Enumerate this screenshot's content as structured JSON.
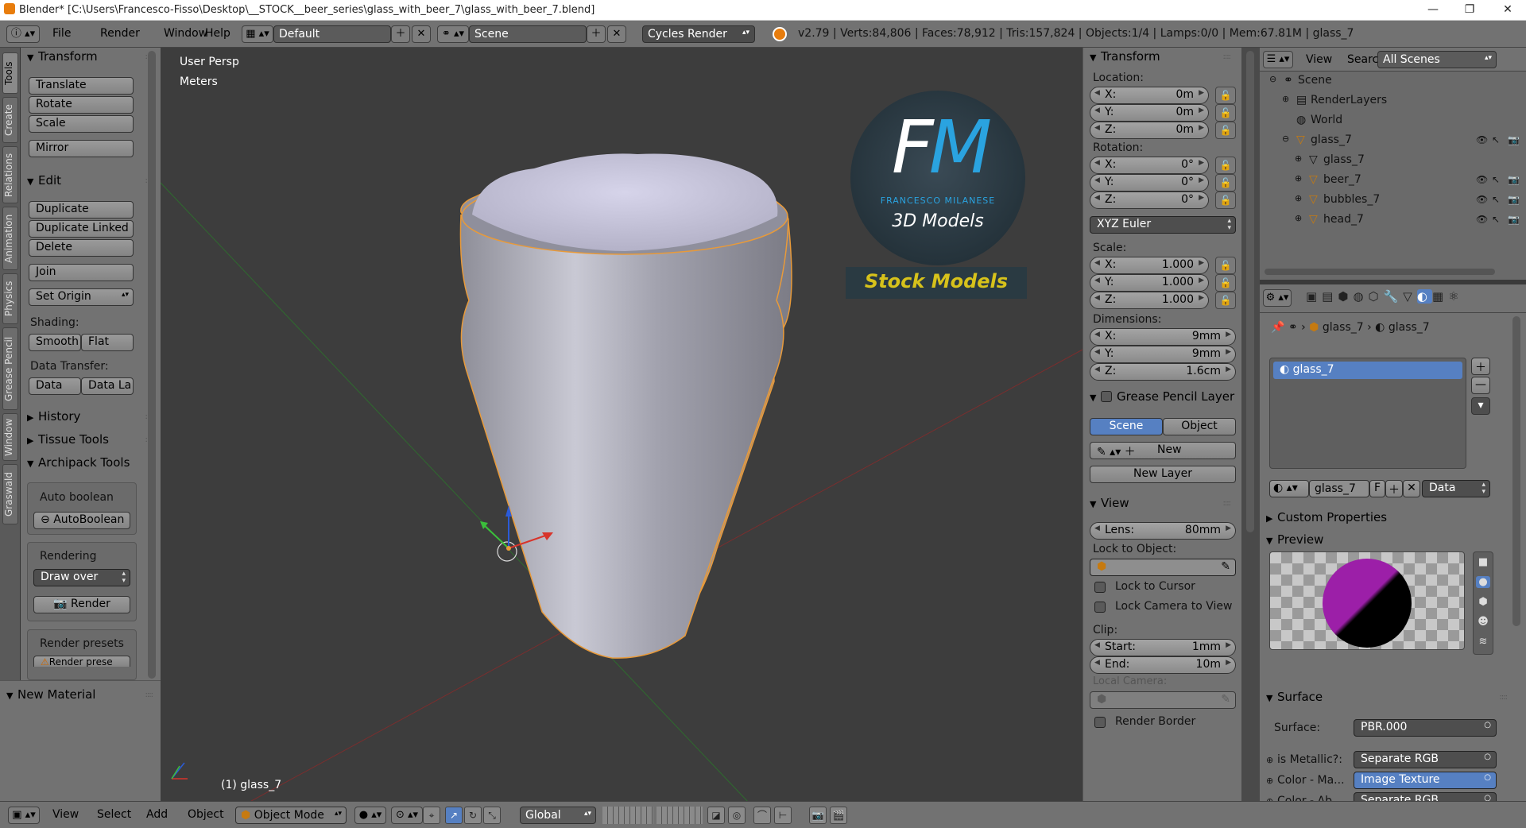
{
  "window": {
    "title": "Blender* [C:\\Users\\Francesco-Fisso\\Desktop\\__STOCK__beer_series\\glass_with_beer_7\\glass_with_beer_7.blend]",
    "minimize": "—",
    "maximize": "❐",
    "close": "✕"
  },
  "header": {
    "menus": [
      "File",
      "Render",
      "Window",
      "Help"
    ],
    "layout": "Default",
    "scene": "Scene",
    "engine": "Cycles Render",
    "stats": "v2.79 | Verts:84,806 | Faces:78,912 | Tris:157,824 | Objects:1/4 | Lamps:0/0 | Mem:67.81M | glass_7"
  },
  "tabs": [
    "Tools",
    "Create",
    "Relations",
    "Animation",
    "Physics",
    "Grease Pencil",
    "Window",
    "Graswald"
  ],
  "toolshelf": {
    "transform": {
      "title": "Transform",
      "buttons": [
        "Translate",
        "Rotate",
        "Scale",
        "Mirror"
      ]
    },
    "edit": {
      "title": "Edit",
      "buttons": [
        "Duplicate",
        "Duplicate Linked",
        "Delete",
        "Join"
      ],
      "set_origin": "Set Origin"
    },
    "shading": {
      "label": "Shading:",
      "smooth": "Smooth",
      "flat": "Flat"
    },
    "data_transfer": {
      "label": "Data Transfer:",
      "data": "Data",
      "data_la": "Data La"
    },
    "history": "History",
    "tissue": "Tissue Tools",
    "archipack": "Archipack Tools",
    "auto_boolean": {
      "label": "Auto boolean",
      "button": "AutoBoolean"
    },
    "rendering": {
      "label": "Rendering",
      "draw_over": "Draw over",
      "render": "Render"
    },
    "render_presets": {
      "label": "Render presets",
      "button": "Render prese"
    },
    "new_material": "New Material"
  },
  "viewport": {
    "view": "User Persp",
    "units": "Meters",
    "object": "(1) glass_7",
    "logo": {
      "fm": "FM",
      "name": "FRANCESCO MILANESE",
      "sub": "3D Models",
      "stock": "Stock Models"
    }
  },
  "npanel": {
    "transform": "Transform",
    "location_label": "Location:",
    "location": [
      {
        "k": "X:",
        "v": "0m"
      },
      {
        "k": "Y:",
        "v": "0m"
      },
      {
        "k": "Z:",
        "v": "0m"
      }
    ],
    "rotation_label": "Rotation:",
    "rotation": [
      {
        "k": "X:",
        "v": "0°"
      },
      {
        "k": "Y:",
        "v": "0°"
      },
      {
        "k": "Z:",
        "v": "0°"
      }
    ],
    "rotation_mode": "XYZ Euler",
    "scale_label": "Scale:",
    "scale": [
      {
        "k": "X:",
        "v": "1.000"
      },
      {
        "k": "Y:",
        "v": "1.000"
      },
      {
        "k": "Z:",
        "v": "1.000"
      }
    ],
    "dimensions_label": "Dimensions:",
    "dimensions": [
      {
        "k": "X:",
        "v": "9mm"
      },
      {
        "k": "Y:",
        "v": "9mm"
      },
      {
        "k": "Z:",
        "v": "1.6cm"
      }
    ],
    "grease_pencil": "Grease Pencil Layer",
    "gp_scene": "Scene",
    "gp_object": "Object",
    "gp_new": "New",
    "gp_new_layer": "New Layer",
    "view": "View",
    "lens_k": "Lens:",
    "lens_v": "80mm",
    "lock_to_object": "Lock to Object:",
    "lock_to_cursor": "Lock to Cursor",
    "lock_camera": "Lock Camera to View",
    "clip": "Clip:",
    "clip_start_k": "Start:",
    "clip_start_v": "1mm",
    "clip_end_k": "End:",
    "clip_end_v": "10m",
    "local_camera": "Local Camera:",
    "render_border": "Render Border"
  },
  "outliner": {
    "view": "View",
    "search": "Search",
    "filter": "All Scenes",
    "items": [
      "Scene",
      "RenderLayers",
      "World",
      "glass_7",
      "glass_7",
      "beer_7",
      "bubbles_7",
      "head_7"
    ]
  },
  "properties": {
    "breadcrumb": [
      "glass_7",
      "glass_7"
    ],
    "slot": "glass_7",
    "material_name": "glass_7",
    "material_f": "F",
    "material_link": "Data",
    "custom_props": "Custom Properties",
    "preview": "Preview",
    "surface": "Surface",
    "surface_label": "Surface:",
    "surface_value": "PBR.000",
    "inputs": [
      {
        "k": "is Metallic?:",
        "v": "Separate RGB"
      },
      {
        "k": "Color - Ma...",
        "v": "Image Texture"
      },
      {
        "k": "Color - Ab...",
        "v": "Separate RGB"
      }
    ]
  },
  "bottom": {
    "menus": [
      "View",
      "Select",
      "Add",
      "Object"
    ],
    "mode": "Object Mode",
    "orientation": "Global"
  },
  "colors": {
    "panel": "#727272",
    "selected": "#5680c2",
    "logo_blue": "#2aa3e0",
    "logo_gold": "#d7c21b",
    "selection_outline": "#f0a030"
  }
}
